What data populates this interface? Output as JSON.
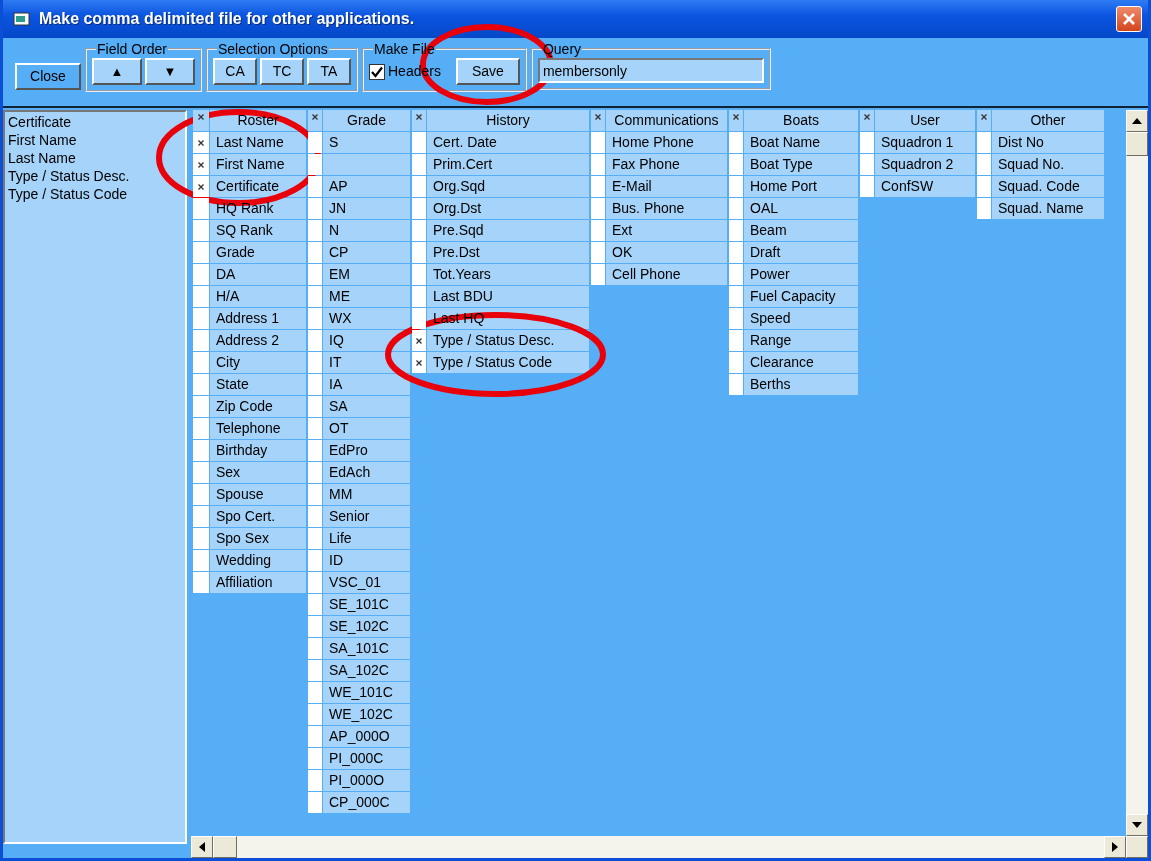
{
  "window": {
    "title": "Make comma delimited file for other applications."
  },
  "toolbar": {
    "close_button": "Close",
    "field_order": {
      "legend": "Field Order",
      "up": "▲",
      "down": "▼"
    },
    "selection_options": {
      "legend": "Selection Options",
      "buttons": [
        "CA",
        "TC",
        "TA"
      ]
    },
    "make_file": {
      "legend": "Make File",
      "headers": {
        "label": "Headers",
        "checked": true
      },
      "save": "Save"
    },
    "query": {
      "legend": "Query",
      "value": "membersonly"
    }
  },
  "selected_fields": [
    "Certificate",
    "First Name",
    "Last Name",
    "Type / Status Desc.",
    "Type / Status Code"
  ],
  "columns": [
    {
      "title": "Roster",
      "header_checked": true,
      "rows": [
        {
          "label": "Last Name",
          "selected": true
        },
        {
          "label": "First Name",
          "selected": true
        },
        {
          "label": "Certificate",
          "selected": true
        },
        {
          "label": "HQ Rank",
          "selected": false
        },
        {
          "label": "SQ Rank",
          "selected": false
        },
        {
          "label": "Grade",
          "selected": false
        },
        {
          "label": "DA",
          "selected": false
        },
        {
          "label": "H/A",
          "selected": false
        },
        {
          "label": "Address 1",
          "selected": false
        },
        {
          "label": "Address 2",
          "selected": false
        },
        {
          "label": "City",
          "selected": false
        },
        {
          "label": "State",
          "selected": false
        },
        {
          "label": "Zip Code",
          "selected": false
        },
        {
          "label": "Telephone",
          "selected": false
        },
        {
          "label": "Birthday",
          "selected": false
        },
        {
          "label": "Sex",
          "selected": false
        },
        {
          "label": "Spouse",
          "selected": false
        },
        {
          "label": "Spo Cert.",
          "selected": false
        },
        {
          "label": "Spo Sex",
          "selected": false
        },
        {
          "label": "Wedding",
          "selected": false
        },
        {
          "label": "Affiliation",
          "selected": false
        }
      ]
    },
    {
      "title": "Grade",
      "header_checked": true,
      "rows": [
        {
          "label": "S",
          "selected": false
        },
        {
          "selected": false
        },
        {
          "label": "AP",
          "selected": false
        },
        {
          "label": "JN",
          "selected": false
        },
        {
          "label": "N",
          "selected": false
        },
        {
          "label": "CP",
          "selected": false
        },
        {
          "label": "EM",
          "selected": false
        },
        {
          "label": "ME",
          "selected": false
        },
        {
          "label": "WX",
          "selected": false
        },
        {
          "label": "IQ",
          "selected": false
        },
        {
          "label": "IT",
          "selected": false
        },
        {
          "label": "IA",
          "selected": false
        },
        {
          "label": "SA",
          "selected": false
        },
        {
          "label": "OT",
          "selected": false
        },
        {
          "label": "EdPro",
          "selected": false
        },
        {
          "label": "EdAch",
          "selected": false
        },
        {
          "label": "MM",
          "selected": false
        },
        {
          "label": "Senior",
          "selected": false
        },
        {
          "label": "Life",
          "selected": false
        },
        {
          "label": "ID",
          "selected": false
        },
        {
          "label": "VSC_01",
          "selected": false
        },
        {
          "label": "SE_101C",
          "selected": false
        },
        {
          "label": "SE_102C",
          "selected": false
        },
        {
          "label": "SA_101C",
          "selected": false
        },
        {
          "label": "SA_102C",
          "selected": false
        },
        {
          "label": "WE_101C",
          "selected": false
        },
        {
          "label": "WE_102C",
          "selected": false
        },
        {
          "label": "AP_000O",
          "selected": false
        },
        {
          "label": "PI_000C",
          "selected": false
        },
        {
          "label": "PI_000O",
          "selected": false
        },
        {
          "label": "CP_000C",
          "selected": false
        }
      ]
    },
    {
      "title": "History",
      "header_checked": true,
      "rows": [
        {
          "label": "Cert. Date",
          "selected": false
        },
        {
          "label": "Prim.Cert",
          "selected": false
        },
        {
          "label": "Org.Sqd",
          "selected": false
        },
        {
          "label": "Org.Dst",
          "selected": false
        },
        {
          "label": "Pre.Sqd",
          "selected": false
        },
        {
          "label": "Pre.Dst",
          "selected": false
        },
        {
          "label": "Tot.Years",
          "selected": false
        },
        {
          "label": "Last BDU",
          "selected": false
        },
        {
          "label": "Last HQ",
          "selected": false
        },
        {
          "label": "Type / Status Desc.",
          "selected": true
        },
        {
          "label": "Type / Status Code",
          "selected": true
        }
      ]
    },
    {
      "title": "Communications",
      "header_checked": true,
      "rows": [
        {
          "label": "Home Phone",
          "selected": false
        },
        {
          "label": "Fax Phone",
          "selected": false
        },
        {
          "label": "E-Mail",
          "selected": false
        },
        {
          "label": "Bus. Phone",
          "selected": false
        },
        {
          "label": "Ext",
          "selected": false
        },
        {
          "label": "OK",
          "selected": false
        },
        {
          "label": "Cell Phone",
          "selected": false
        }
      ]
    },
    {
      "title": "Boats",
      "header_checked": true,
      "rows": [
        {
          "label": "Boat Name",
          "selected": false
        },
        {
          "label": "Boat Type",
          "selected": false
        },
        {
          "label": "Home Port",
          "selected": false
        },
        {
          "label": "OAL",
          "selected": false
        },
        {
          "label": "Beam",
          "selected": false
        },
        {
          "label": "Draft",
          "selected": false
        },
        {
          "label": "Power",
          "selected": false
        },
        {
          "label": "Fuel Capacity",
          "selected": false
        },
        {
          "label": "Speed",
          "selected": false
        },
        {
          "label": "Range",
          "selected": false
        },
        {
          "label": "Clearance",
          "selected": false
        },
        {
          "label": "Berths",
          "selected": false
        }
      ]
    },
    {
      "title": "User",
      "header_checked": true,
      "rows": [
        {
          "label": "Squadron 1",
          "selected": false
        },
        {
          "label": "Squadron 2",
          "selected": false
        },
        {
          "label": "ConfSW",
          "selected": false
        }
      ]
    },
    {
      "title": "Other",
      "header_checked": true,
      "rows": [
        {
          "label": "Dist No",
          "selected": false
        },
        {
          "label": "Squad No.",
          "selected": false
        },
        {
          "label": "Squad. Code",
          "selected": false
        },
        {
          "label": "Squad. Name",
          "selected": false
        }
      ]
    }
  ],
  "annotations": [
    {
      "kind": "ellipse"
    },
    {
      "kind": "ellipse"
    },
    {
      "kind": "ellipse"
    }
  ]
}
